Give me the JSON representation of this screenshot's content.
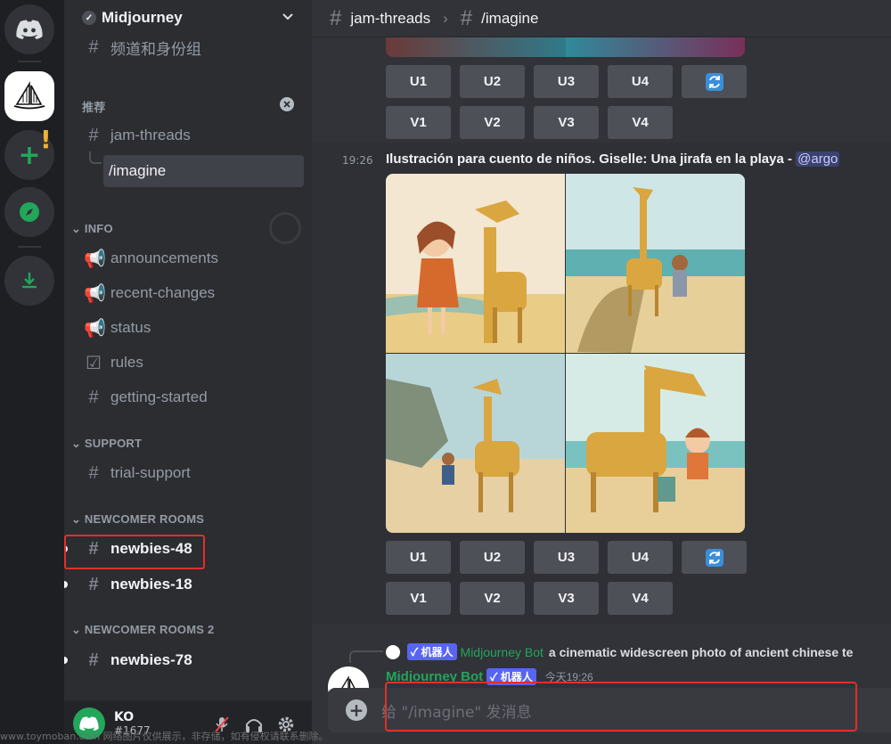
{
  "server_rail": {
    "items": [
      "discord-home",
      "midjourney-server",
      "add-server",
      "explore",
      "download"
    ]
  },
  "guild": {
    "name": "Midjourney",
    "browse_label": "频道和身份组"
  },
  "sections": {
    "recommended_label": "推荐",
    "info_label": "INFO",
    "support_label": "SUPPORT",
    "newcomer_label": "NEWCOMER ROOMS",
    "newcomer2_label": "NEWCOMER ROOMS 2"
  },
  "channels": {
    "jam_threads": "jam-threads",
    "imagine": "/imagine",
    "announcements": "announcements",
    "recent_changes": "recent-changes",
    "status": "status",
    "rules": "rules",
    "getting_started": "getting-started",
    "trial_support": "trial-support",
    "newbies_48": "newbies-48",
    "newbies_18": "newbies-18",
    "newbies_78": "newbies-78"
  },
  "user": {
    "name": "KO",
    "tag": "#1677"
  },
  "header": {
    "parent": "jam-threads",
    "thread": "/imagine"
  },
  "buttons": {
    "u": [
      "U1",
      "U2",
      "U3",
      "U4"
    ],
    "v": [
      "V1",
      "V2",
      "V3",
      "V4"
    ]
  },
  "message": {
    "time": "19:26",
    "prompt": "Ilustración para cuento de niños. Giselle: Una jirafa en la playa - ",
    "mention": "@argo"
  },
  "reply": {
    "bot_tag": "✓ 机器人",
    "bot_name": "Midjourney Bot",
    "text": "a cinematic widescreen photo of ancient chinese te"
  },
  "message2": {
    "author": "Midjourney Bot",
    "bot_tag": "✓ 机器人",
    "time": "今天19:26"
  },
  "composer": {
    "placeholder": "给 \"/imagine\" 发消息"
  },
  "watermark": "www.toymoban.com 网络图片仅供展示，非存储，如有侵权请联系删除。",
  "colors": {
    "accent": "#5865f2",
    "highlight": "#e0302a",
    "bot_green": "#23a55a"
  }
}
